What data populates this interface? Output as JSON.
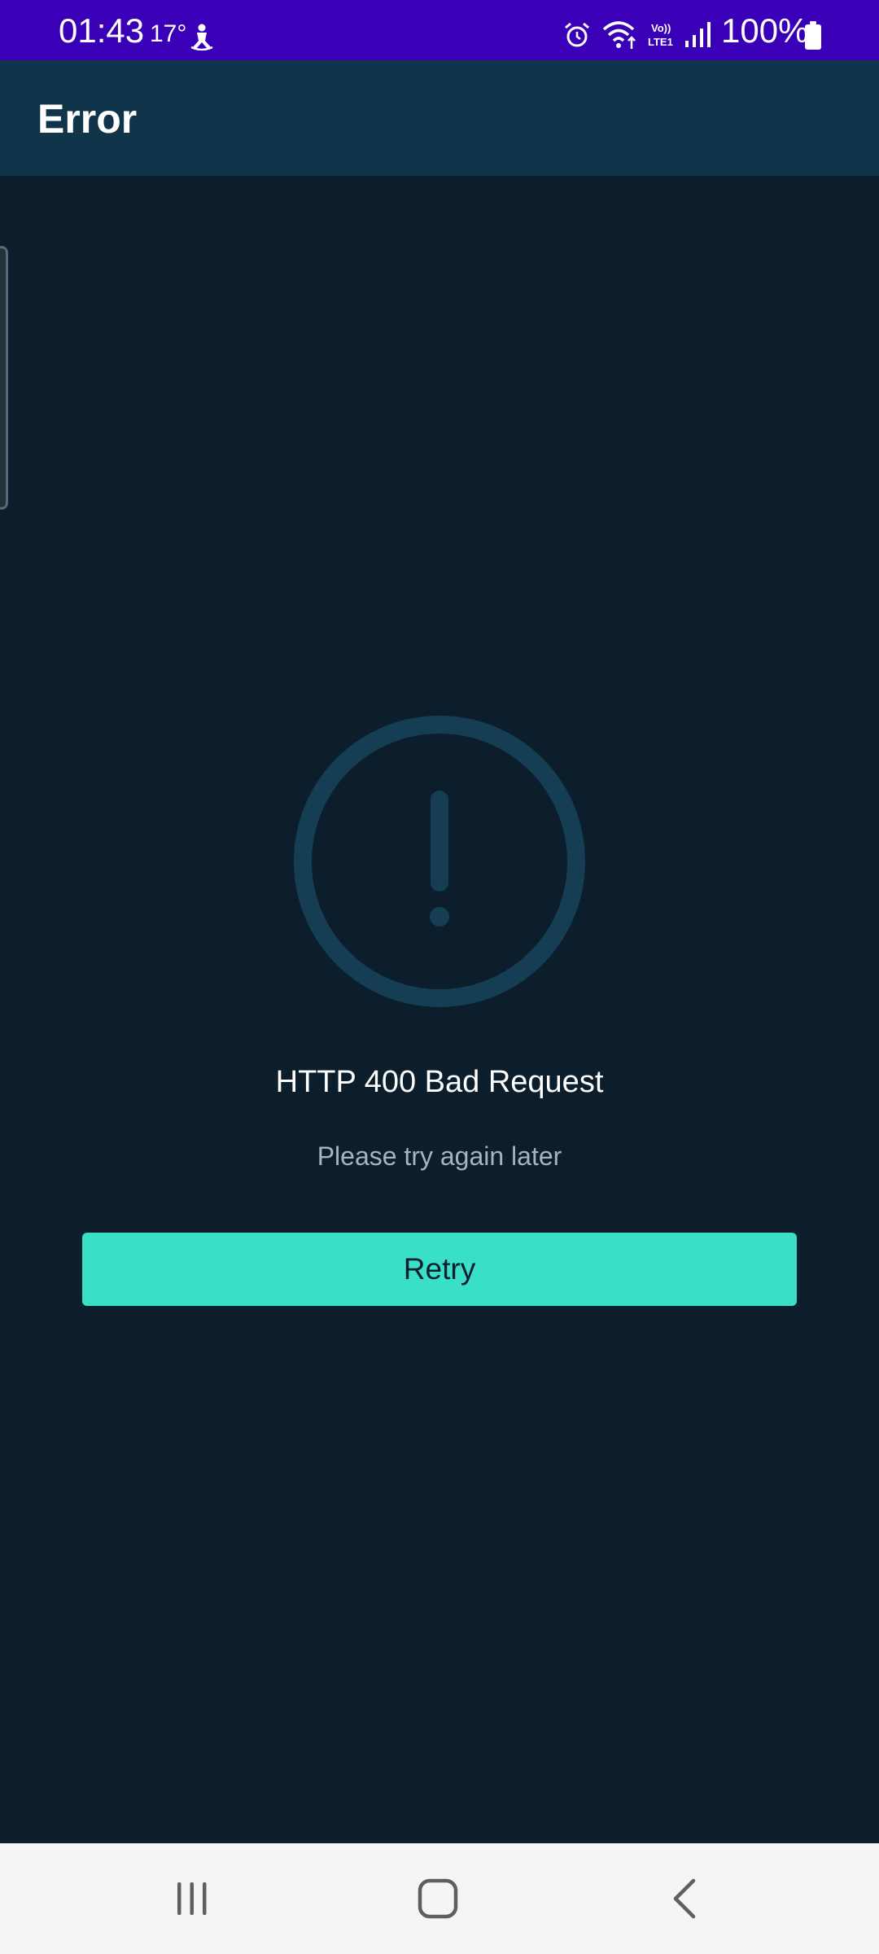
{
  "status_bar": {
    "time": "01:43",
    "temperature": "17°",
    "battery_percent": "100%",
    "icons": [
      "person-icon",
      "alarm-icon",
      "wifi-icon",
      "volte-icon",
      "signal-icon",
      "battery-icon"
    ]
  },
  "app_bar": {
    "title": "Error"
  },
  "error": {
    "icon": "exclamation-circle-icon",
    "title": "HTTP 400 Bad Request",
    "subtitle": "Please try again later",
    "retry_label": "Retry"
  },
  "nav_bar": {
    "icons": [
      "recents-icon",
      "home-icon",
      "back-icon"
    ]
  },
  "colors": {
    "status_bar": "#3a00b8",
    "app_bar": "#10344a",
    "background": "#0c1e2b",
    "accent": "#3adfc8",
    "icon_muted": "#153d54"
  }
}
